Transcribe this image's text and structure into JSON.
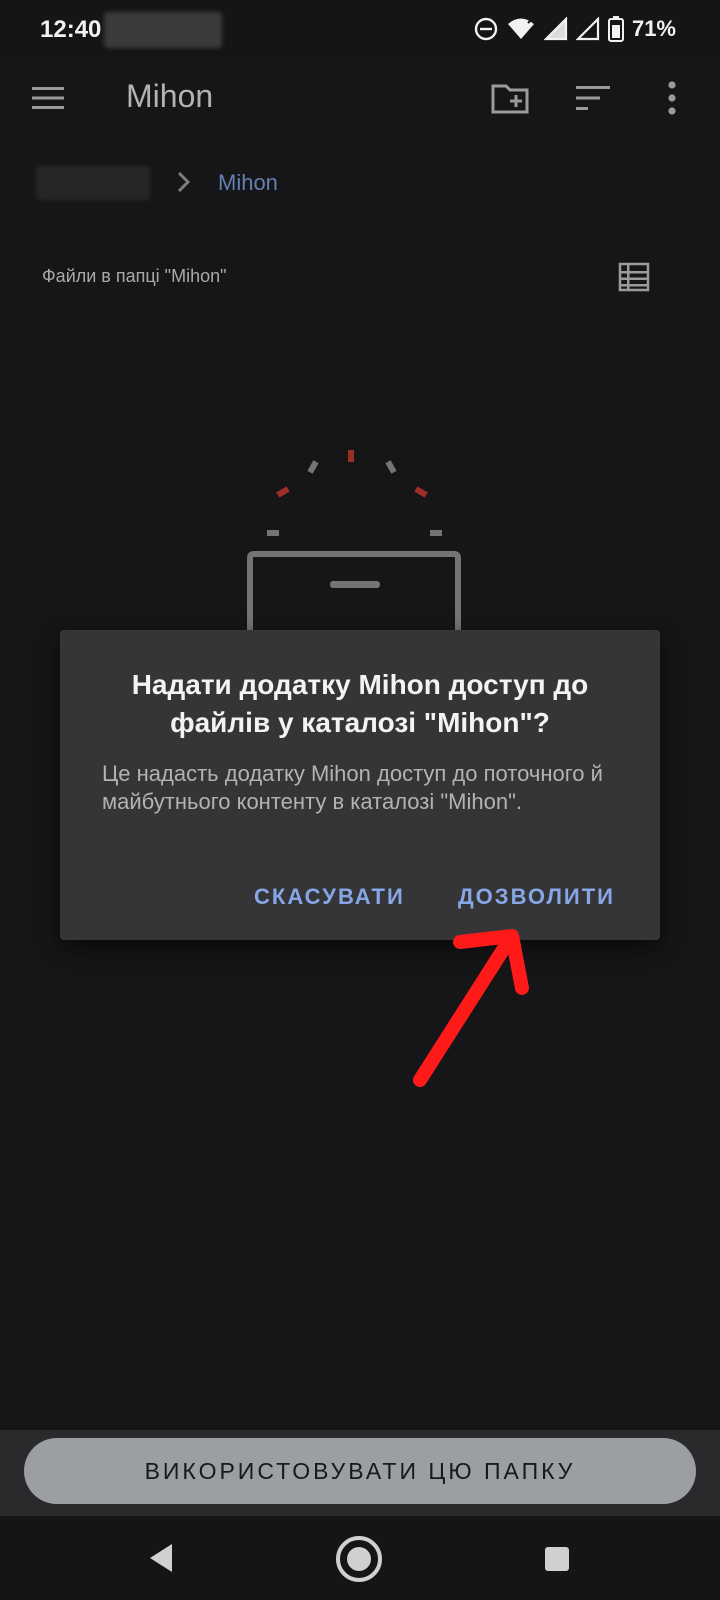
{
  "status_bar": {
    "time": "12:40",
    "battery_percent": "71%",
    "icons": [
      "do-not-disturb-icon",
      "wifi-icon",
      "signal-icon",
      "signal-icon",
      "battery-icon"
    ]
  },
  "app_bar": {
    "title": "Mihon",
    "icons": [
      "menu-icon",
      "new-folder-icon",
      "sort-icon",
      "more-vert-icon"
    ]
  },
  "breadcrumb": {
    "current": "Mihon"
  },
  "files": {
    "header": "Файли в папці \"Mihon\"",
    "view_icon": "list-view-icon"
  },
  "dialog": {
    "title": "Надати додатку Mihon доступ до файлів у каталозі \"Mihon\"?",
    "message": "Це надасть додатку Mihon доступ до поточного й майбутнього контенту в каталозі \"Mihon\".",
    "cancel_label": "СКАСУВАТИ",
    "allow_label": "ДОЗВОЛИТИ"
  },
  "bottom": {
    "use_folder_label": "ВИКОРИСТОВУВАТИ ЦЮ ПАПКУ"
  },
  "nav": {
    "icons": [
      "back-icon",
      "home-icon",
      "recents-icon"
    ]
  },
  "colors": {
    "background": "#1c1c1e",
    "dialog": "#353537",
    "accent": "#86a6e6",
    "annotation": "#ff1a1a"
  }
}
